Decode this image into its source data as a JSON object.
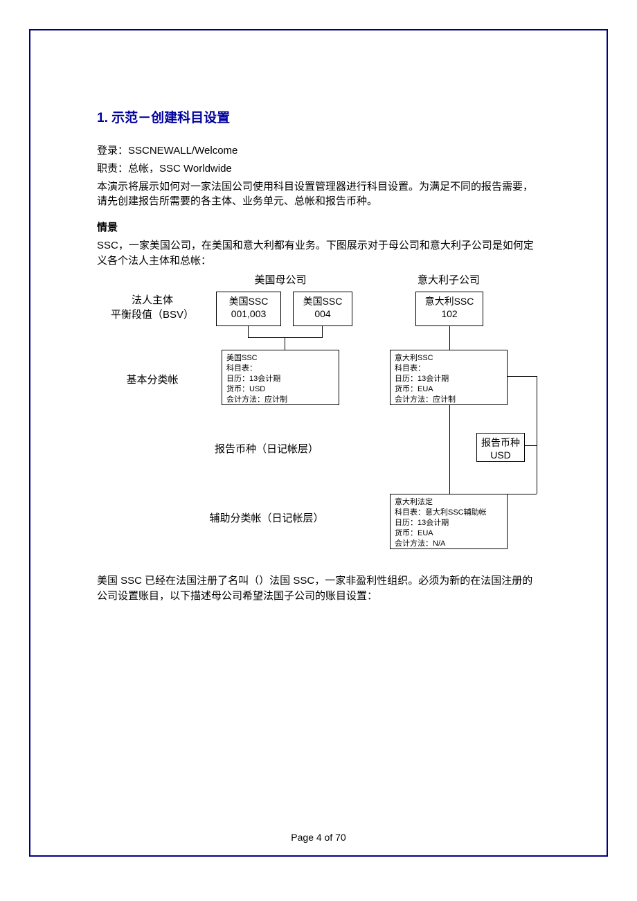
{
  "heading": "1. 示范－创建科目设置",
  "login_line": "登录：SSCNEWALL/Welcome",
  "role_line": "职责：总帐，SSC Worldwide",
  "intro": "本演示将展示如何对一家法国公司使用科目设置管理器进行科目设置。为满足不同的报告需要，请先创建报告所需要的各主体、业务单元、总帐和报告币种。",
  "scenario_label": "情景",
  "scenario_text": "SSC，一家美国公司，在美国和意大利都有业务。下图展示对于母公司和意大利子公司是如何定义各个法人主体和总帐：",
  "diagram": {
    "col_us": "美国母公司",
    "col_it": "意大利子公司",
    "row_entity_l1": "法人主体",
    "row_entity_l2": "平衡段值（BSV）",
    "row_primary": "基本分类帐",
    "row_report_curr": "报告币种（日记帐层）",
    "row_secondary": "辅助分类帐（日记帐层）",
    "us_box1_l1": "美国SSC",
    "us_box1_l2": "001,003",
    "us_box2_l1": "美国SSC",
    "us_box2_l2": "004",
    "it_box1_l1": "意大利SSC",
    "it_box1_l2": "102",
    "us_ledger_l1": "美国SSC",
    "us_ledger_l2": "科目表：",
    "us_ledger_l3": "日历：13会计期",
    "us_ledger_l4": "货币：USD",
    "us_ledger_l5": "会计方法：应计制",
    "it_ledger_l1": "意大利SSC",
    "it_ledger_l2": "科目表：",
    "it_ledger_l3": "日历：13会计期",
    "it_ledger_l4": "货币：EUA",
    "it_ledger_l5": "会计方法：应计制",
    "rc_l1": "报告币种",
    "rc_l2": "USD",
    "sec_l1": "意大利法定",
    "sec_l2": "科目表：意大利SSC辅助帐",
    "sec_l3": "日历：13会计期",
    "sec_l4": "货币：EUA",
    "sec_l5": "会计方法：N/A"
  },
  "closing": "美国 SSC 已经在法国注册了名叫（）法国 SSC，一家非盈利性组织。必须为新的在法国注册的公司设置账目，以下描述母公司希望法国子公司的账目设置：",
  "footer": "Page 4 of 70"
}
